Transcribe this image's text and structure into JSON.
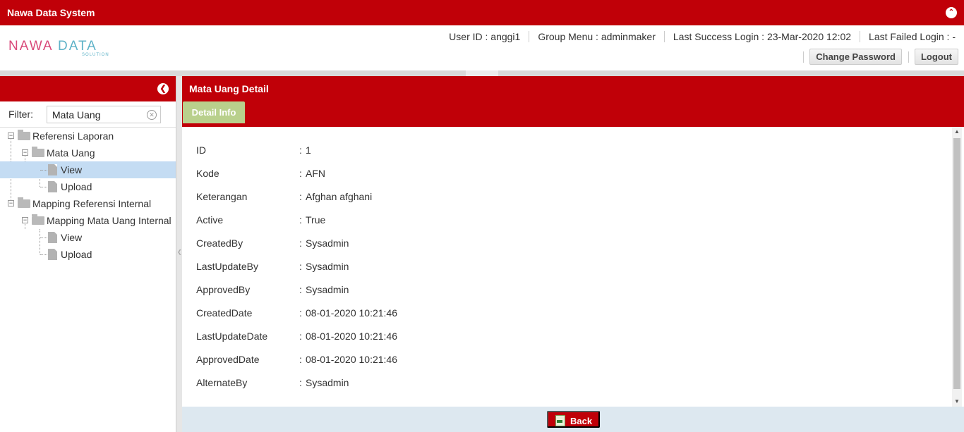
{
  "app": {
    "title": "Nawa Data System"
  },
  "logo": {
    "main": "NAWADATA",
    "sub": "SOLUTIONS"
  },
  "header": {
    "user_id": "User ID : anggi1",
    "group_menu": "Group Menu : adminmaker",
    "last_success": "Last Success Login : 23-Mar-2020 12:02",
    "last_failed": "Last Failed Login : -",
    "change_password": "Change Password",
    "logout": "Logout"
  },
  "sidebar": {
    "filter_label": "Filter:",
    "filter_value": "Mata Uang",
    "tree": {
      "n1": "Referensi Laporan",
      "n1a": "Mata Uang",
      "n1a1": "View",
      "n1a2": "Upload",
      "n2": "Mapping Referensi Internal",
      "n2a": "Mapping Mata Uang Internal",
      "n2a1": "View",
      "n2a2": "Upload"
    }
  },
  "main": {
    "title": "Mata Uang Detail",
    "tab": "Detail Info",
    "fields": [
      {
        "label": "ID",
        "value": "1"
      },
      {
        "label": "Kode",
        "value": "AFN"
      },
      {
        "label": "Keterangan",
        "value": "Afghan afghani"
      },
      {
        "label": "Active",
        "value": "True"
      },
      {
        "label": "CreatedBy",
        "value": "Sysadmin"
      },
      {
        "label": "LastUpdateBy",
        "value": "Sysadmin"
      },
      {
        "label": "ApprovedBy",
        "value": "Sysadmin"
      },
      {
        "label": "CreatedDate",
        "value": "08-01-2020 10:21:46"
      },
      {
        "label": "LastUpdateDate",
        "value": "08-01-2020 10:21:46"
      },
      {
        "label": "ApprovedDate",
        "value": "08-01-2020 10:21:46"
      },
      {
        "label": "AlternateBy",
        "value": "Sysadmin"
      }
    ],
    "separator": ":",
    "back": "Back"
  },
  "colors": {
    "brand_red": "#c00008",
    "tab_green": "#b9d08c",
    "selection": "#c4dcf3"
  }
}
